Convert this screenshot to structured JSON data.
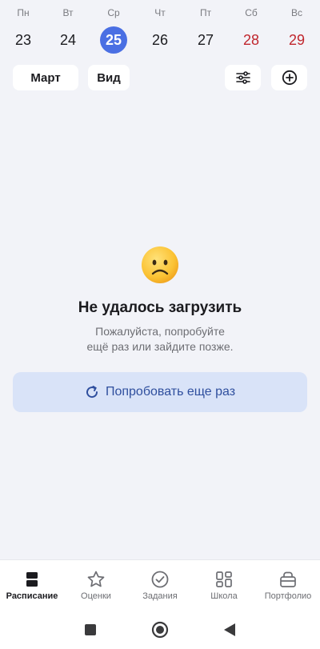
{
  "week": {
    "days": [
      {
        "name": "Пн",
        "date": "23"
      },
      {
        "name": "Вт",
        "date": "24"
      },
      {
        "name": "Ср",
        "date": "25"
      },
      {
        "name": "Чт",
        "date": "26"
      },
      {
        "name": "Пт",
        "date": "27"
      },
      {
        "name": "Сб",
        "date": "28"
      },
      {
        "name": "Вс",
        "date": "29"
      }
    ],
    "selected_date": "25"
  },
  "toolbar": {
    "month_label": "Март",
    "view_label": "Вид",
    "filter_icon": "sliders-icon",
    "add_icon": "plus-circle-icon"
  },
  "error": {
    "emoji": "sad-face",
    "title": "Не удалось загрузить",
    "message_line1": "Пожалуйста, попробуйте",
    "message_line2": "ещё раз или зайдите позже.",
    "retry_label": "Попробовать еще раз"
  },
  "bottom_nav": {
    "items": [
      {
        "label": "Расписание",
        "icon": "schedule-icon",
        "active": true
      },
      {
        "label": "Оценки",
        "icon": "star-icon",
        "active": false
      },
      {
        "label": "Задания",
        "icon": "check-circle-icon",
        "active": false
      },
      {
        "label": "Школа",
        "icon": "grid-icon",
        "active": false
      },
      {
        "label": "Портфолио",
        "icon": "briefcase-icon",
        "active": false
      }
    ]
  },
  "colors": {
    "accent": "#4a6fe3",
    "weekend": "#c0262d",
    "retry_bg": "#d9e3f8",
    "retry_text": "#2f4f9e",
    "background": "#f2f3f8"
  }
}
